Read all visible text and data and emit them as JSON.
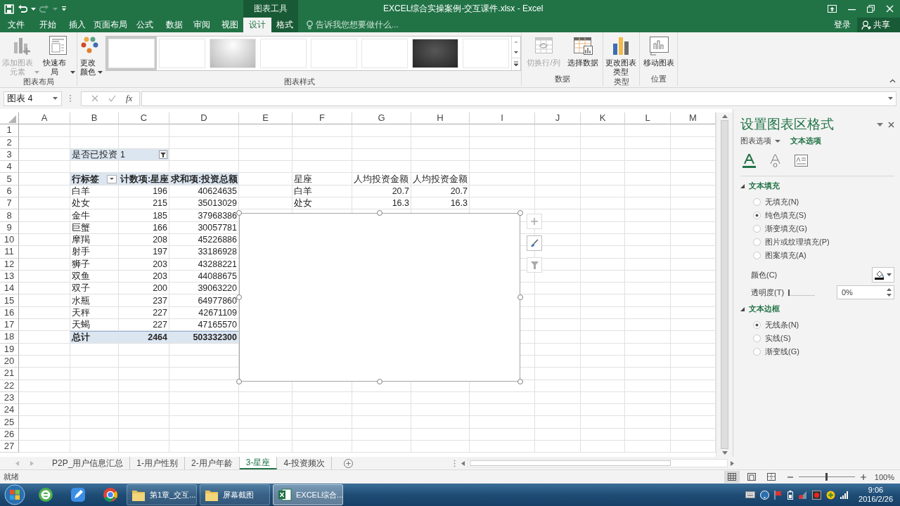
{
  "quick_access": [
    {
      "kind": "save",
      "disabled": false
    },
    {
      "kind": "undo",
      "disabled": false
    },
    {
      "kind": "redo",
      "disabled": true
    }
  ],
  "contextual_group": {
    "label": "图表工具"
  },
  "window": {
    "title": "EXCEL综合实操案例-交互课件.xlsx - Excel"
  },
  "ribbon_tabs": [
    {
      "label": "文件",
      "selected": false,
      "contextual": false
    },
    {
      "label": "开始",
      "selected": false,
      "contextual": false
    },
    {
      "label": "插入",
      "selected": false,
      "contextual": false
    },
    {
      "label": "页面布局",
      "selected": false,
      "contextual": false
    },
    {
      "label": "公式",
      "selected": false,
      "contextual": false
    },
    {
      "label": "数据",
      "selected": false,
      "contextual": false
    },
    {
      "label": "审阅",
      "selected": false,
      "contextual": false
    },
    {
      "label": "视图",
      "selected": false,
      "contextual": false
    },
    {
      "label": "设计",
      "selected": true,
      "contextual": true
    },
    {
      "label": "格式",
      "selected": false,
      "contextual": true
    }
  ],
  "tell_me": {
    "placeholder": "告诉我您想要做什么..."
  },
  "account": {
    "sign_in": "登录",
    "share": "共享"
  },
  "ribbon_groups": [
    {
      "label": "图表布局",
      "buttons": [
        {
          "kind": "add_element",
          "label": "添加图表元素",
          "disabled": true,
          "menu": true
        },
        {
          "kind": "quick_layout",
          "label": "快速布局",
          "disabled": false,
          "menu": true
        }
      ]
    },
    {
      "label": "图表样式",
      "buttons": [
        {
          "kind": "change_colors",
          "label": "更改颜色",
          "disabled": false,
          "menu": true
        }
      ],
      "gallery": [
        {
          "kind": "white",
          "selected": true
        },
        {
          "kind": "white",
          "selected": false
        },
        {
          "kind": "gradient",
          "selected": false
        },
        {
          "kind": "white",
          "selected": false
        },
        {
          "kind": "white",
          "selected": false
        },
        {
          "kind": "white",
          "selected": false
        },
        {
          "kind": "dark",
          "selected": false
        },
        {
          "kind": "white",
          "selected": false
        }
      ]
    },
    {
      "label": "数据",
      "buttons": [
        {
          "kind": "switch_row_column",
          "label": "切换行/列",
          "disabled": true,
          "menu": false
        },
        {
          "kind": "select_data",
          "label": "选择数据",
          "disabled": false,
          "menu": false
        }
      ]
    },
    {
      "label": "类型",
      "buttons": [
        {
          "kind": "change_type",
          "label": "更改图表类型",
          "disabled": false,
          "menu": false
        }
      ]
    },
    {
      "label": "位置",
      "buttons": [
        {
          "kind": "move_chart",
          "label": "移动图表",
          "disabled": false,
          "menu": false
        }
      ]
    }
  ],
  "formula_bar": {
    "name_box": "图表 4",
    "function_label": "fx"
  },
  "sheet": {
    "columns": [
      "A",
      "B",
      "C",
      "D",
      "E",
      "F",
      "G",
      "H",
      "I",
      "J",
      "K",
      "L",
      "M"
    ],
    "row_numbers": [
      "1",
      "2",
      "3",
      "4",
      "5",
      "6",
      "7",
      "8",
      "9",
      "10",
      "11",
      "12",
      "13",
      "14",
      "15",
      "16",
      "17",
      "18",
      "19",
      "20",
      "21",
      "22",
      "23",
      "24",
      "25",
      "26",
      "27"
    ]
  },
  "pivot_table": {
    "filter": {
      "field": "是否已投资",
      "value": "1"
    },
    "header": [
      "行标签",
      "计数项:星座",
      "求和项:投资总额"
    ],
    "rows": [
      [
        "白羊",
        "196",
        "40624635"
      ],
      [
        "处女",
        "215",
        "35013029"
      ],
      [
        "金牛",
        "185",
        "37968386"
      ],
      [
        "巨蟹",
        "166",
        "30057781"
      ],
      [
        "摩羯",
        "208",
        "45226886"
      ],
      [
        "射手",
        "197",
        "33186928"
      ],
      [
        "狮子",
        "203",
        "43288221"
      ],
      [
        "双鱼",
        "203",
        "44088675"
      ],
      [
        "双子",
        "200",
        "39063220"
      ],
      [
        "水瓶",
        "237",
        "64977860"
      ],
      [
        "天秤",
        "227",
        "42671109"
      ],
      [
        "天蝎",
        "227",
        "47165570"
      ]
    ],
    "total": [
      "总计",
      "2464",
      "503332300"
    ]
  },
  "table": {
    "header": [
      "星座",
      "人均投资金额",
      "人均投资金额"
    ],
    "rows": [
      [
        "白羊",
        "20.7",
        "20.7"
      ],
      [
        "处女",
        "16.3",
        "16.3"
      ]
    ]
  },
  "chart": {
    "selected": true
  },
  "format_pane": {
    "title": "设置图表区格式",
    "tabs": [
      {
        "label": "图表选项",
        "selected": false
      },
      {
        "label": "文本选项",
        "selected": true
      }
    ],
    "icon_tabs": [
      {
        "kind": "fill",
        "selected": true
      },
      {
        "kind": "outline",
        "selected": false
      },
      {
        "kind": "textbox",
        "selected": false
      }
    ],
    "sections": [
      {
        "label": "文本填充",
        "expanded": true,
        "options": [
          {
            "label": "无填充(N)",
            "selected": false
          },
          {
            "label": "纯色填充(S)",
            "selected": true
          },
          {
            "label": "渐变填充(G)",
            "selected": false
          },
          {
            "label": "图片或纹理填充(P)",
            "selected": false
          },
          {
            "label": "图案填充(A)",
            "selected": false
          }
        ],
        "color_label": "颜色(C)",
        "transparency": {
          "label": "透明度(T)",
          "level": 0,
          "reading": "0%"
        }
      },
      {
        "label": "文本边框",
        "expanded": true,
        "options": [
          {
            "label": "无线条(N)",
            "selected": true
          },
          {
            "label": "实线(S)",
            "selected": false
          },
          {
            "label": "渐变线(G)",
            "selected": false
          }
        ]
      }
    ]
  },
  "sheet_tabs": [
    {
      "label": "P2P_用户信息汇总",
      "selected": false
    },
    {
      "label": "1-用户性别",
      "selected": false
    },
    {
      "label": "2-用户年龄",
      "selected": false
    },
    {
      "label": "3-星座",
      "selected": true
    },
    {
      "label": "4-投资频次",
      "selected": false
    }
  ],
  "status": {
    "text": "就绪",
    "views": [
      {
        "kind": "normal",
        "selected": true
      },
      {
        "kind": "page_layout",
        "selected": false
      },
      {
        "kind": "page_break",
        "selected": false
      }
    ],
    "zoom": {
      "level": 0.5,
      "reading": "100%"
    }
  },
  "taskbar": {
    "pinned": [
      {
        "kind": "ie"
      },
      {
        "kind": "pen"
      },
      {
        "kind": "chrome"
      }
    ],
    "tasks": [
      {
        "kind": "folder",
        "label": "第1章_交互...",
        "selected": false
      },
      {
        "kind": "folder",
        "label": "屏幕截图",
        "selected": false
      },
      {
        "kind": "excel",
        "label": "EXCEL综合...",
        "selected": true
      }
    ],
    "clock": {
      "time": "9:06",
      "date": "2016/2/26"
    }
  }
}
